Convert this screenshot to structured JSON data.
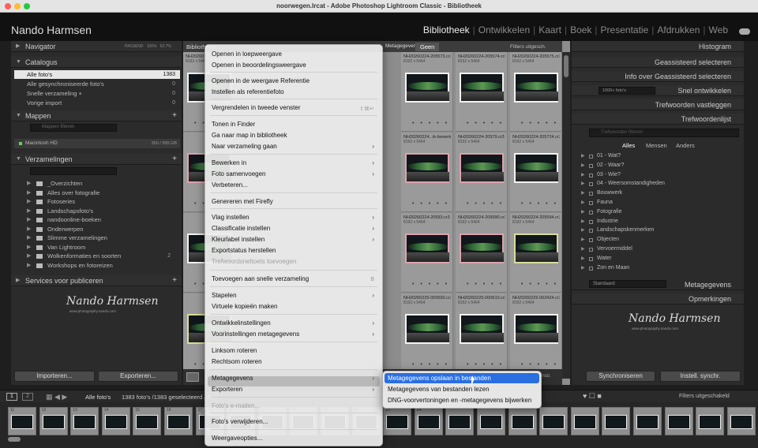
{
  "window": {
    "title": "noorwegen.lrcat - Adobe Photoshop Lightroom Classic - Bibliotheek"
  },
  "identity": {
    "name": "Nando Harmsen"
  },
  "modules": [
    "Bibliotheek",
    "Ontwikkelen",
    "Kaart",
    "Boek",
    "Presentatie",
    "Afdrukken",
    "Web"
  ],
  "left": {
    "navigator": "Navigator",
    "nav_opts": [
      "PASSEND",
      "100%",
      "62.7%"
    ],
    "catalog": "Catalogus",
    "catalog_items": [
      {
        "label": "Alle foto's",
        "count": "1383"
      },
      {
        "label": "Alle gesynchroniseerde foto's",
        "count": "0"
      },
      {
        "label": "Snelle verzameling +",
        "count": "0"
      },
      {
        "label": "Vorige import",
        "count": "0"
      }
    ],
    "folders": "Mappen",
    "folder_search": "Mappen filteren",
    "drive": "Macintosh HD",
    "drive_space": "350 / 995 GB",
    "collections": "Verzamelingen",
    "collection_items": [
      {
        "label": "_Overzichten",
        "count": ""
      },
      {
        "label": "Alles over fotografie",
        "count": ""
      },
      {
        "label": "Fotoseries",
        "count": ""
      },
      {
        "label": "Landschapsfoto's",
        "count": ""
      },
      {
        "label": "nandoonline-boeken",
        "count": ""
      },
      {
        "label": "Onderwerpen",
        "count": ""
      },
      {
        "label": "Slimme verzamelingen",
        "count": ""
      },
      {
        "label": "Van Lightroom",
        "count": ""
      },
      {
        "label": "Wolkenformaties en soorten",
        "count": "2"
      },
      {
        "label": "Workshops en fotoreizen",
        "count": ""
      }
    ],
    "publish": "Services voor publiceren",
    "signature": "Nando Harmsen",
    "signature_sub": "www.photography.nando.com",
    "import_btn": "Importeren...",
    "export_btn": "Exporteren..."
  },
  "right": {
    "histogram": "Histogram",
    "quick_select": "Geassisteerd selecteren",
    "info": "Info over Geassisteerd selecteren",
    "quick_develop": "Snel ontwikkelen",
    "preset": "1000+ foto's",
    "keywording": "Trefwoorden vastleggen",
    "keyword_list": "Trefwoordenlijst",
    "keyword_search": "Trefwoorden filteren",
    "kw_tabs": [
      "Alles",
      "Mensen",
      "Anders"
    ],
    "keywords": [
      "01 - Wat?",
      "02 - Waar?",
      "03 - Wie?",
      "04 - Weersomstandigheden",
      "Bouwwerk",
      "Fauna",
      "Fotografie",
      "Industrie",
      "Landschapskenmerken",
      "Objecten",
      "Vervoermiddel",
      "Water",
      "Zon en Maan"
    ],
    "metadata_preset": "Standaard",
    "metadata": "Metagegevens",
    "comments": "Opmerkingen",
    "sync_btn": "Synchroniseren",
    "sync_settings_btn": "Instell. synchr."
  },
  "grid": {
    "filterbar": [
      "Bibliotheek",
      "Metagegevens",
      "Geen",
      "Filters uitgesch."
    ],
    "cells": [
      {
        "name": "NH20260224-2055...",
        "size": "8192 x 5464"
      },
      {
        "name": "NH20260224-205573.cr3",
        "size": "8192 x 5464"
      },
      {
        "name": "NH20260224-205574.cr3",
        "size": "8192 x 5464"
      },
      {
        "name": "NH20260224-205575.cr3",
        "size": "8192 x 5464"
      },
      {
        "name": "NH20260224...ik-bewerkt.tif",
        "size": "8192 x 5464"
      },
      {
        "name": "NH20260224-20579.cr3",
        "size": "8192 x 5464"
      },
      {
        "name": "NH20260224-205724.cr3",
        "size": "8192 x 5464"
      },
      {
        "name": "NH20260224-20593.cr3",
        "size": "8192 x 5464"
      },
      {
        "name": "NH20260224-205990.cr3",
        "size": "8192 x 5464"
      },
      {
        "name": "NH20260224-205594.cr3",
        "size": "8192 x 5464"
      },
      {
        "name": "NH20260225-000593.cr3",
        "size": "8192 x 5464"
      },
      {
        "name": "NH20260225-000610.cr3",
        "size": "8192 x 5464"
      },
      {
        "name": "NH20260225-002424.cr3",
        "size": "8192 x 5464"
      }
    ]
  },
  "context_menu": {
    "items": [
      "Openen in loepweergave",
      "Openen in beoordelingsweergave",
      "Openen in de weergave Referentie",
      "Instellen als referentiefoto",
      "Vergrendelen in tweede venster",
      "Tonen in Finder",
      "Ga naar map in bibliotheek",
      "Naar verzameling gaan",
      "Bewerken in",
      "Foto samenvoegen",
      "Verbeteren...",
      "Genereren met Firefly",
      "Vlag instellen",
      "Classificatie instellen",
      "Kleurlabel instellen",
      "Exportstatus herstellen",
      "Trefwoordsneltoets toevoegen",
      "Toevoegen aan snelle verzameling",
      "Stapelen",
      "Virtuele kopieën maken",
      "Ontwikkelinstellingen",
      "Voorinstellingen metagegevens",
      "Linksom roteren",
      "Rechtsom roteren",
      "Metagegevens",
      "Exporteren",
      "Foto's e-mailen...",
      "Foto's verwijderen...",
      "Weergaveopties..."
    ],
    "shortcut_lock": "⇧⌘↵",
    "shortcut_quick": "B"
  },
  "submenu": {
    "items": [
      "Metagegevens opslaan in bestanden",
      "Metagegevens van bestanden lezen",
      "DNG-voorvertoningen en -metagegevens bijwerken"
    ]
  },
  "filmstrip": {
    "pages": [
      "1",
      "2"
    ],
    "source": "Alle foto's",
    "count_text": "1383 foto's /1383 geselecteerd / N",
    "filters": "Filters uitgeschakeld",
    "frame_numbers": [
      "11",
      "12",
      "13",
      "14",
      "15",
      "16",
      "17",
      "18",
      "19",
      "20",
      "21",
      "22",
      "23",
      "24"
    ]
  },
  "toolbar": {
    "thumb_label": "Miniat."
  }
}
